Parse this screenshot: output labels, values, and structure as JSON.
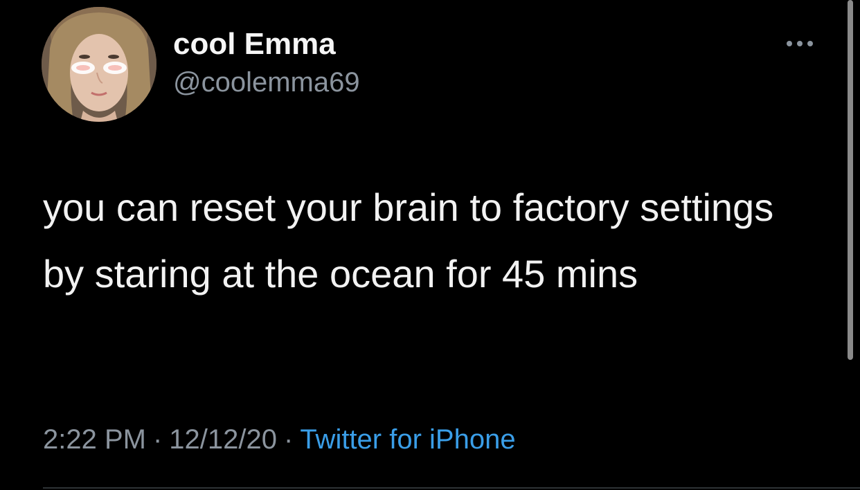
{
  "author": {
    "display_name": "cool Emma",
    "handle": "@coolemma69",
    "avatar_icon": "profile-photo"
  },
  "more_menu": {
    "icon": "more-horizontal-icon"
  },
  "tweet": {
    "text": "you can reset your brain to factory settings by staring at the ocean for 45 mins"
  },
  "meta": {
    "time": "2:22 PM",
    "separator": "·",
    "date": "12/12/20",
    "source": "Twitter for iPhone"
  },
  "colors": {
    "background": "#000000",
    "text": "#f2f2f2",
    "secondary": "#8b949e",
    "link": "#3a9ee8"
  }
}
